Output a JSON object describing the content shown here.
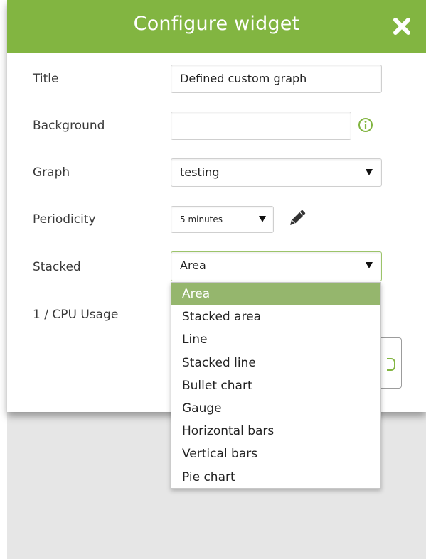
{
  "dialog": {
    "title": "Configure widget",
    "close_icon": "close-icon"
  },
  "form": {
    "title_label": "Title",
    "title_value": "Defined custom graph",
    "background_label": "Background",
    "background_value": "",
    "info_icon": "info-circle-icon",
    "graph_label": "Graph",
    "graph_value": "testing",
    "periodicity_label": "Periodicity",
    "periodicity_value": "5 minutes",
    "edit_icon": "pencil-icon",
    "stacked_label": "Stacked",
    "stacked_value": "Area",
    "cpu_label": "1 / CPU Usage"
  },
  "stacked_options": [
    "Area",
    "Stacked area",
    "Line",
    "Stacked line",
    "Bullet chart",
    "Gauge",
    "Horizontal bars",
    "Vertical bars",
    "Pie chart"
  ],
  "colors": {
    "accent": "#82b541",
    "selected_option": "#95b66d",
    "overlay": "#e6e6e6"
  }
}
